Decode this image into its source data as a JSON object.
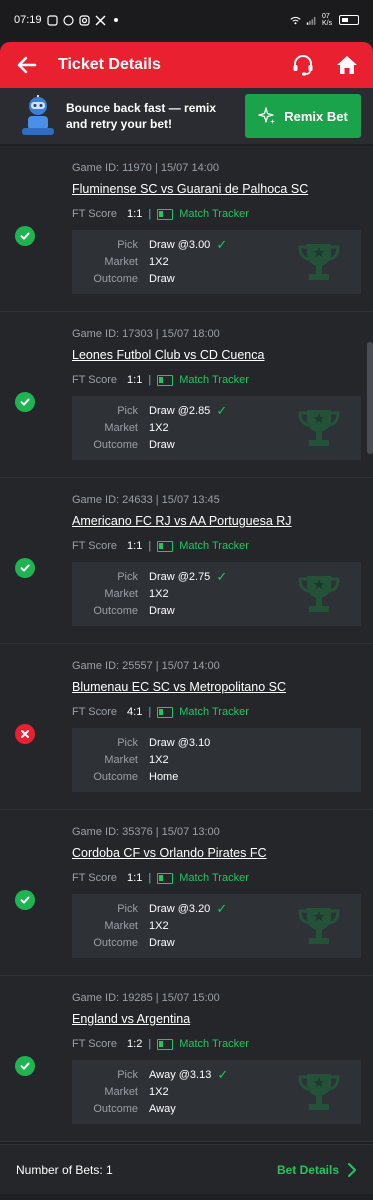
{
  "status_bar": {
    "time": "07:19",
    "battery_icon": "battery-icon",
    "signal_text": "07 K/s"
  },
  "header": {
    "title": "Ticket Details"
  },
  "promo": {
    "text": "Bounce back fast — remix and retry your bet!",
    "button_label": "Remix Bet"
  },
  "labels": {
    "ft_score": "FT Score",
    "pick": "Pick",
    "market": "Market",
    "outcome": "Outcome",
    "tracker": "Match Tracker",
    "separator": "|"
  },
  "bets": [
    {
      "game": "Game ID: 11970 | 15/07 14:00",
      "match": "Fluminense SC vs Guarani de Palhoca SC",
      "score": "1:1",
      "pick": "Draw @3.00",
      "market": "1X2",
      "outcome": "Draw",
      "won": true
    },
    {
      "game": "Game ID: 17303 | 15/07 18:00",
      "match": "Leones Futbol Club vs CD Cuenca",
      "score": "1:1",
      "pick": "Draw @2.85",
      "market": "1X2",
      "outcome": "Draw",
      "won": true
    },
    {
      "game": "Game ID: 24633 | 15/07 13:45",
      "match": "Americano FC RJ vs AA Portuguesa RJ",
      "score": "1:1",
      "pick": "Draw @2.75",
      "market": "1X2",
      "outcome": "Draw",
      "won": true
    },
    {
      "game": "Game ID: 25557 | 15/07 14:00",
      "match": "Blumenau EC SC vs Metropolitano SC",
      "score": "4:1",
      "pick": "Draw @3.10",
      "market": "1X2",
      "outcome": "Home",
      "won": false
    },
    {
      "game": "Game ID: 35376 | 15/07 13:00",
      "match": "Cordoba CF vs Orlando Pirates FC",
      "score": "1:1",
      "pick": "Draw @3.20",
      "market": "1X2",
      "outcome": "Draw",
      "won": true
    },
    {
      "game": "Game ID: 19285 | 15/07 15:00",
      "match": "England vs Argentina",
      "score": "1:2",
      "pick": "Away @3.13",
      "market": "1X2",
      "outcome": "Away",
      "won": true
    }
  ],
  "footer": {
    "count": "Number of Bets: 1",
    "details_label": "Bet Details"
  },
  "colors": {
    "brand_red": "#e8202f",
    "accent_green": "#22c55e",
    "button_green": "#1aa34a"
  }
}
